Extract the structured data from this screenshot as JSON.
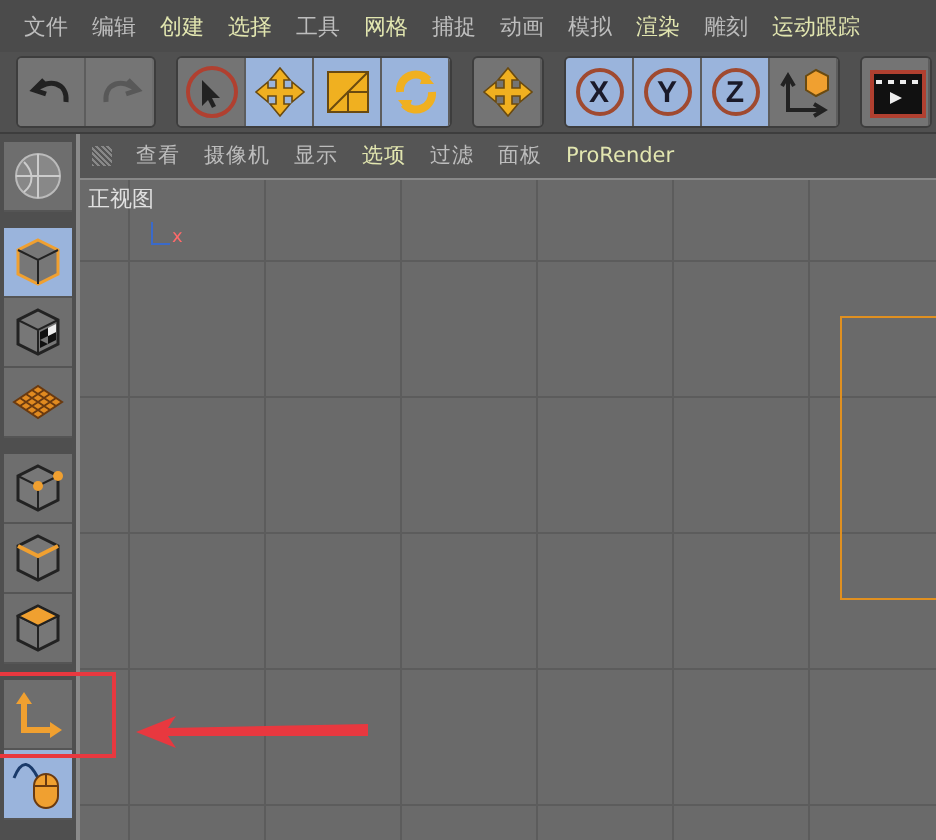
{
  "menu_bar": [
    {
      "label": "文件",
      "highlighted": false
    },
    {
      "label": "编辑",
      "highlighted": false
    },
    {
      "label": "创建",
      "highlighted": true
    },
    {
      "label": "选择",
      "highlighted": true
    },
    {
      "label": "工具",
      "highlighted": false
    },
    {
      "label": "网格",
      "highlighted": true
    },
    {
      "label": "捕捉",
      "highlighted": false
    },
    {
      "label": "动画",
      "highlighted": false
    },
    {
      "label": "模拟",
      "highlighted": false
    },
    {
      "label": "渲染",
      "highlighted": true
    },
    {
      "label": "雕刻",
      "highlighted": false
    },
    {
      "label": "运动跟踪",
      "highlighted": true
    }
  ],
  "toolbar": [
    {
      "buttons": [
        {
          "kind": "undo",
          "selected": false,
          "disabled": false
        },
        {
          "kind": "redo",
          "selected": false,
          "disabled": true
        }
      ]
    },
    {
      "buttons": [
        {
          "kind": "select",
          "selected": false,
          "disabled": false
        },
        {
          "kind": "move",
          "selected": true,
          "disabled": false
        },
        {
          "kind": "scale",
          "selected": true,
          "disabled": false
        },
        {
          "kind": "rotate",
          "selected": true,
          "disabled": false
        }
      ]
    },
    {
      "buttons": [
        {
          "kind": "move",
          "selected": false,
          "disabled": false
        }
      ]
    },
    {
      "buttons": [
        {
          "kind": "axis-lock",
          "label": "X",
          "selected": true,
          "disabled": false
        },
        {
          "kind": "axis-lock",
          "label": "Y",
          "selected": true,
          "disabled": false
        },
        {
          "kind": "axis-lock",
          "label": "Z",
          "selected": true,
          "disabled": false
        },
        {
          "kind": "coordinates",
          "selected": false,
          "disabled": false
        }
      ]
    },
    {
      "buttons": [
        {
          "kind": "render",
          "selected": false,
          "disabled": false
        }
      ]
    }
  ],
  "left_toolbar": [
    {
      "kind": "sculpt",
      "selected": false,
      "annotated": false
    },
    {
      "kind": "model",
      "selected": true,
      "annotated": false
    },
    {
      "kind": "texture",
      "selected": false,
      "annotated": false
    },
    {
      "kind": "workplane",
      "selected": false,
      "annotated": false
    },
    {
      "kind": "points",
      "selected": false,
      "annotated": false
    },
    {
      "kind": "edges",
      "selected": false,
      "annotated": false
    },
    {
      "kind": "polygons",
      "selected": false,
      "annotated": false
    },
    {
      "kind": "axis",
      "selected": false,
      "annotated": true
    },
    {
      "kind": "tweak",
      "selected": true,
      "annotated": false
    }
  ],
  "viewport": {
    "menu": [
      {
        "label": "查看",
        "highlighted": false
      },
      {
        "label": "摄像机",
        "highlighted": false
      },
      {
        "label": "显示",
        "highlighted": false
      },
      {
        "label": "选项",
        "highlighted": true
      },
      {
        "label": "过滤",
        "highlighted": false
      },
      {
        "label": "面板",
        "highlighted": false
      },
      {
        "label": "ProRender",
        "highlighted": true
      }
    ],
    "view_label": "正视图",
    "axis_label": "x"
  }
}
